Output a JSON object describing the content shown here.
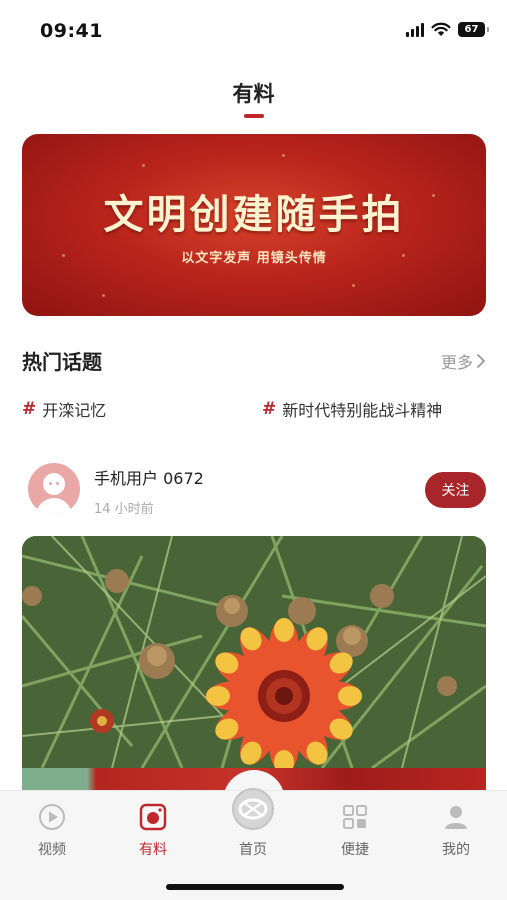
{
  "status_bar": {
    "time": "09:41",
    "battery": "67"
  },
  "header": {
    "title": "有料"
  },
  "banner": {
    "title": "文明创建随手拍",
    "subtitle": "以文字发声 用镜头传情"
  },
  "hot_topics": {
    "title": "热门话题",
    "more_label": "更多",
    "topics": [
      {
        "hash": "#",
        "label": "开滦记忆"
      },
      {
        "hash": "#",
        "label": "新时代特别能战斗精神"
      }
    ]
  },
  "post": {
    "username": "手机用户 0672",
    "time": "14 小时前",
    "follow_label": "关注"
  },
  "tab_bar": {
    "items": [
      {
        "label": "视频",
        "icon": "play-icon",
        "active": false
      },
      {
        "label": "有料",
        "icon": "camera-icon",
        "active": true
      },
      {
        "label": "首页",
        "icon": "home-logo-icon",
        "active": false
      },
      {
        "label": "便捷",
        "icon": "grid-icon",
        "active": false
      },
      {
        "label": "我的",
        "icon": "user-icon",
        "active": false
      }
    ]
  },
  "colors": {
    "accent": "#c0272d",
    "follow_button": "#a8262a",
    "banner_red": "#b8241c"
  }
}
